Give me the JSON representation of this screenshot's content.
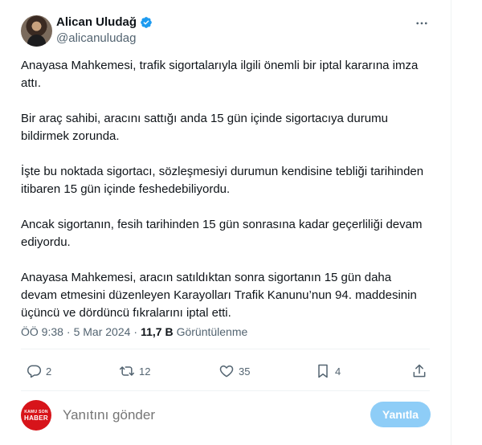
{
  "author": {
    "display_name": "Alican Uludağ",
    "handle": "@alicanuludag",
    "verified": true
  },
  "tweet": {
    "paragraphs": [
      "Anayasa Mahkemesi, trafik sigortalarıyla ilgili önemli bir iptal kararına imza attı.",
      "Bir araç sahibi, aracını sattığı anda 15 gün içinde sigortacıya durumu bildirmek zorunda.",
      "İşte bu noktada sigortacı, sözleşmesiyi durumun kendisine tebliği tarihinden itibaren 15 gün içinde feshedebiliyordu.",
      "Ancak sigortanın, fesih tarihinden 15 gün sonrasına kadar geçerliliği devam ediyordu.",
      "Anayasa Mahkemesi, aracın satıldıktan sonra sigortanın 15 gün daha devam etmesini düzenleyen Karayolları Trafik Kanunu’nun 94. maddesinin üçüncü ve dördüncü fıkralarını iptal etti."
    ],
    "time": "ÖÖ 9:38",
    "separator": "·",
    "date": "5 Mar 2024",
    "views_count": "11,7 B",
    "views_label": "Görüntülenme"
  },
  "actions": {
    "replies": "2",
    "retweets": "12",
    "likes": "35",
    "bookmarks": "4"
  },
  "reply_box": {
    "placeholder": "Yanıtını gönder",
    "button_label": "Yanıtla",
    "avatar_text_top": "KAMU SON",
    "avatar_text_bottom": "HABER"
  },
  "colors": {
    "verified": "#1d9bf0",
    "reply_button": "#8ecdf7",
    "secondary_text": "#536471"
  },
  "icons": [
    "verified-badge-icon",
    "more-icon",
    "reply-icon",
    "retweet-icon",
    "like-icon",
    "bookmark-icon",
    "share-icon"
  ]
}
